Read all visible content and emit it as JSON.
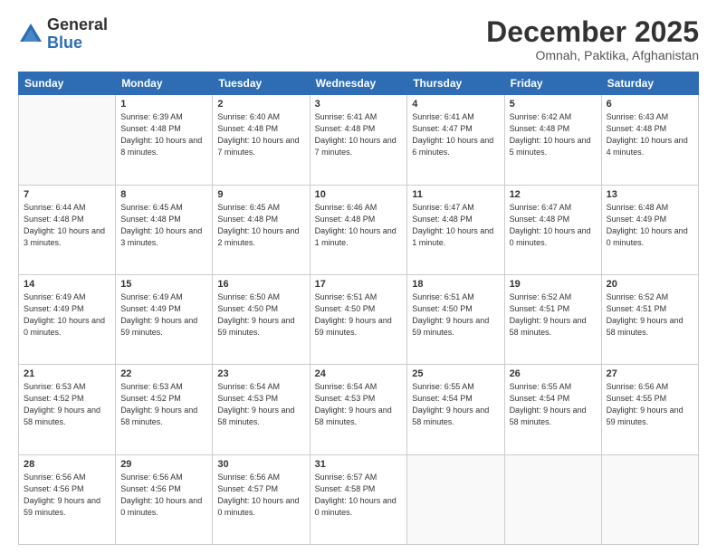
{
  "logo": {
    "general": "General",
    "blue": "Blue"
  },
  "header": {
    "month": "December 2025",
    "location": "Omnah, Paktika, Afghanistan"
  },
  "weekdays": [
    "Sunday",
    "Monday",
    "Tuesday",
    "Wednesday",
    "Thursday",
    "Friday",
    "Saturday"
  ],
  "weeks": [
    [
      {
        "day": "",
        "empty": true
      },
      {
        "day": "1",
        "sunrise": "Sunrise: 6:39 AM",
        "sunset": "Sunset: 4:48 PM",
        "daylight": "Daylight: 10 hours and 8 minutes."
      },
      {
        "day": "2",
        "sunrise": "Sunrise: 6:40 AM",
        "sunset": "Sunset: 4:48 PM",
        "daylight": "Daylight: 10 hours and 7 minutes."
      },
      {
        "day": "3",
        "sunrise": "Sunrise: 6:41 AM",
        "sunset": "Sunset: 4:48 PM",
        "daylight": "Daylight: 10 hours and 7 minutes."
      },
      {
        "day": "4",
        "sunrise": "Sunrise: 6:41 AM",
        "sunset": "Sunset: 4:47 PM",
        "daylight": "Daylight: 10 hours and 6 minutes."
      },
      {
        "day": "5",
        "sunrise": "Sunrise: 6:42 AM",
        "sunset": "Sunset: 4:48 PM",
        "daylight": "Daylight: 10 hours and 5 minutes."
      },
      {
        "day": "6",
        "sunrise": "Sunrise: 6:43 AM",
        "sunset": "Sunset: 4:48 PM",
        "daylight": "Daylight: 10 hours and 4 minutes."
      }
    ],
    [
      {
        "day": "7",
        "sunrise": "Sunrise: 6:44 AM",
        "sunset": "Sunset: 4:48 PM",
        "daylight": "Daylight: 10 hours and 3 minutes."
      },
      {
        "day": "8",
        "sunrise": "Sunrise: 6:45 AM",
        "sunset": "Sunset: 4:48 PM",
        "daylight": "Daylight: 10 hours and 3 minutes."
      },
      {
        "day": "9",
        "sunrise": "Sunrise: 6:45 AM",
        "sunset": "Sunset: 4:48 PM",
        "daylight": "Daylight: 10 hours and 2 minutes."
      },
      {
        "day": "10",
        "sunrise": "Sunrise: 6:46 AM",
        "sunset": "Sunset: 4:48 PM",
        "daylight": "Daylight: 10 hours and 1 minute."
      },
      {
        "day": "11",
        "sunrise": "Sunrise: 6:47 AM",
        "sunset": "Sunset: 4:48 PM",
        "daylight": "Daylight: 10 hours and 1 minute."
      },
      {
        "day": "12",
        "sunrise": "Sunrise: 6:47 AM",
        "sunset": "Sunset: 4:48 PM",
        "daylight": "Daylight: 10 hours and 0 minutes."
      },
      {
        "day": "13",
        "sunrise": "Sunrise: 6:48 AM",
        "sunset": "Sunset: 4:49 PM",
        "daylight": "Daylight: 10 hours and 0 minutes."
      }
    ],
    [
      {
        "day": "14",
        "sunrise": "Sunrise: 6:49 AM",
        "sunset": "Sunset: 4:49 PM",
        "daylight": "Daylight: 10 hours and 0 minutes."
      },
      {
        "day": "15",
        "sunrise": "Sunrise: 6:49 AM",
        "sunset": "Sunset: 4:49 PM",
        "daylight": "Daylight: 9 hours and 59 minutes."
      },
      {
        "day": "16",
        "sunrise": "Sunrise: 6:50 AM",
        "sunset": "Sunset: 4:50 PM",
        "daylight": "Daylight: 9 hours and 59 minutes."
      },
      {
        "day": "17",
        "sunrise": "Sunrise: 6:51 AM",
        "sunset": "Sunset: 4:50 PM",
        "daylight": "Daylight: 9 hours and 59 minutes."
      },
      {
        "day": "18",
        "sunrise": "Sunrise: 6:51 AM",
        "sunset": "Sunset: 4:50 PM",
        "daylight": "Daylight: 9 hours and 59 minutes."
      },
      {
        "day": "19",
        "sunrise": "Sunrise: 6:52 AM",
        "sunset": "Sunset: 4:51 PM",
        "daylight": "Daylight: 9 hours and 58 minutes."
      },
      {
        "day": "20",
        "sunrise": "Sunrise: 6:52 AM",
        "sunset": "Sunset: 4:51 PM",
        "daylight": "Daylight: 9 hours and 58 minutes."
      }
    ],
    [
      {
        "day": "21",
        "sunrise": "Sunrise: 6:53 AM",
        "sunset": "Sunset: 4:52 PM",
        "daylight": "Daylight: 9 hours and 58 minutes."
      },
      {
        "day": "22",
        "sunrise": "Sunrise: 6:53 AM",
        "sunset": "Sunset: 4:52 PM",
        "daylight": "Daylight: 9 hours and 58 minutes."
      },
      {
        "day": "23",
        "sunrise": "Sunrise: 6:54 AM",
        "sunset": "Sunset: 4:53 PM",
        "daylight": "Daylight: 9 hours and 58 minutes."
      },
      {
        "day": "24",
        "sunrise": "Sunrise: 6:54 AM",
        "sunset": "Sunset: 4:53 PM",
        "daylight": "Daylight: 9 hours and 58 minutes."
      },
      {
        "day": "25",
        "sunrise": "Sunrise: 6:55 AM",
        "sunset": "Sunset: 4:54 PM",
        "daylight": "Daylight: 9 hours and 58 minutes."
      },
      {
        "day": "26",
        "sunrise": "Sunrise: 6:55 AM",
        "sunset": "Sunset: 4:54 PM",
        "daylight": "Daylight: 9 hours and 58 minutes."
      },
      {
        "day": "27",
        "sunrise": "Sunrise: 6:56 AM",
        "sunset": "Sunset: 4:55 PM",
        "daylight": "Daylight: 9 hours and 59 minutes."
      }
    ],
    [
      {
        "day": "28",
        "sunrise": "Sunrise: 6:56 AM",
        "sunset": "Sunset: 4:56 PM",
        "daylight": "Daylight: 9 hours and 59 minutes."
      },
      {
        "day": "29",
        "sunrise": "Sunrise: 6:56 AM",
        "sunset": "Sunset: 4:56 PM",
        "daylight": "Daylight: 10 hours and 0 minutes."
      },
      {
        "day": "30",
        "sunrise": "Sunrise: 6:56 AM",
        "sunset": "Sunset: 4:57 PM",
        "daylight": "Daylight: 10 hours and 0 minutes."
      },
      {
        "day": "31",
        "sunrise": "Sunrise: 6:57 AM",
        "sunset": "Sunset: 4:58 PM",
        "daylight": "Daylight: 10 hours and 0 minutes."
      },
      {
        "day": "",
        "empty": true
      },
      {
        "day": "",
        "empty": true
      },
      {
        "day": "",
        "empty": true
      }
    ]
  ]
}
